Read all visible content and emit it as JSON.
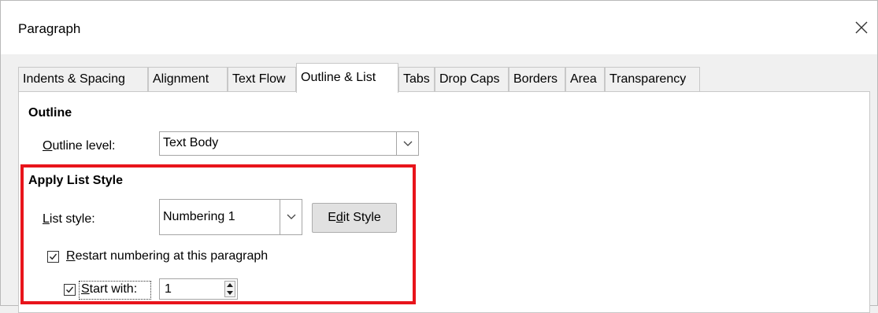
{
  "dialog": {
    "title": "Paragraph",
    "close_icon": "close-icon"
  },
  "tabs": [
    {
      "label": "Indents & Spacing",
      "active": false
    },
    {
      "label": "Alignment",
      "active": false
    },
    {
      "label": "Text Flow",
      "active": false
    },
    {
      "label": "Outline & List",
      "active": true
    },
    {
      "label": "Tabs",
      "active": false
    },
    {
      "label": "Drop Caps",
      "active": false
    },
    {
      "label": "Borders",
      "active": false
    },
    {
      "label": "Area",
      "active": false
    },
    {
      "label": "Transparency",
      "active": false
    }
  ],
  "outline": {
    "heading": "Outline",
    "level_label_first": "O",
    "level_label_rest": "utline level:",
    "level_value": "Text Body"
  },
  "list_style": {
    "heading": "Apply List Style",
    "style_label_first": "L",
    "style_label_rest": "ist style:",
    "style_value": "Numbering 1",
    "edit_button_pre": "E",
    "edit_button_u": "d",
    "edit_button_post": "it Style",
    "restart_label_first": "R",
    "restart_label_rest": "estart numbering at this paragraph",
    "restart_checked": true,
    "start_with_first": "S",
    "start_with_rest": "tart with:",
    "start_with_checked": true,
    "start_with_value": "1"
  },
  "colors": {
    "highlight": "#e8141b",
    "panel": "#ffffff",
    "window": "#f0f0f0"
  }
}
